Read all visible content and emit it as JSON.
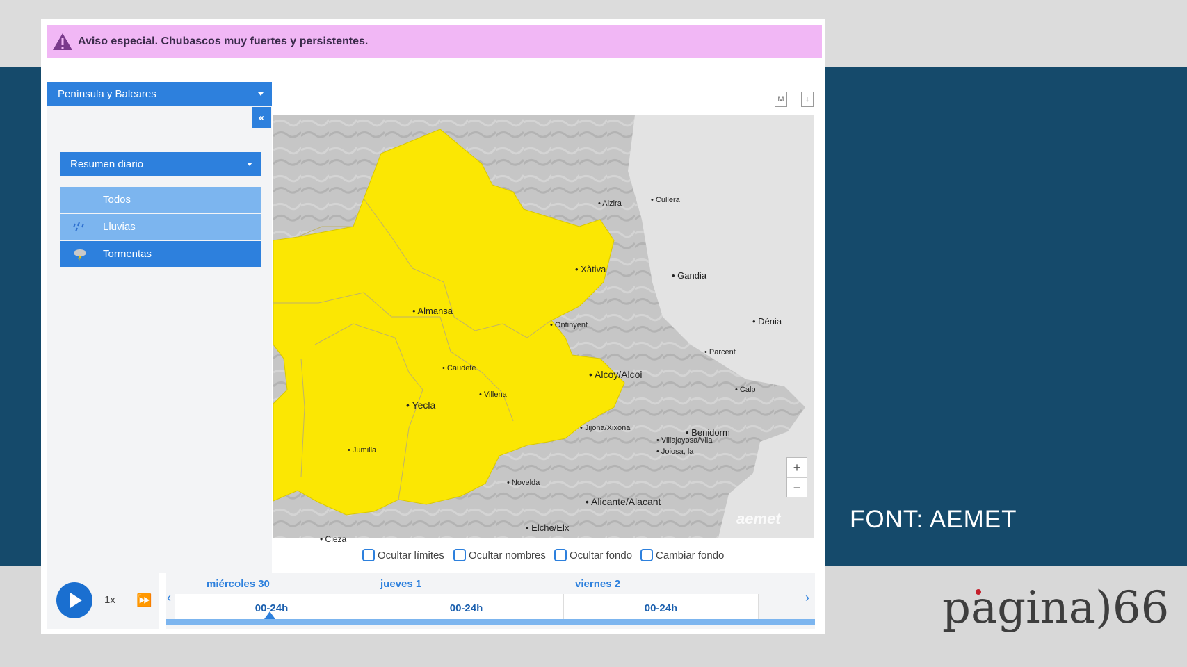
{
  "alert": {
    "text": "Aviso especial. Chubascos muy fuertes y persistentes.",
    "icon": "warning-icon"
  },
  "sidebar": {
    "region": "Península y Baleares",
    "collapse_label": "«",
    "summary": "Resumen diario",
    "filters": [
      {
        "label": "Todos",
        "icon": ""
      },
      {
        "label": "Lluvias",
        "icon": "rain-icon"
      },
      {
        "label": "Tormentas",
        "icon": "storm-icon"
      }
    ]
  },
  "toolbar": {
    "m_label": "M",
    "download_label": "↓"
  },
  "map": {
    "warning_color": "#fbe703",
    "zoom_in": "+",
    "zoom_out": "−",
    "watermark": "aemet",
    "places": [
      "Alzira",
      "Cullera",
      "Xàtiva",
      "Gandia",
      "Almansa",
      "Ontinyent",
      "Dénia",
      "Parcent",
      "Caudete",
      "Alcoy/Alcoi",
      "Calp",
      "Villena",
      "Yecla",
      "Jijona/Xixona",
      "Benidorm",
      "Villajoyosa/Vila",
      "Joiosa, la",
      "Jumilla",
      "Novelda",
      "Alicante/Alacant",
      "Elche/Elx",
      "Cieza"
    ]
  },
  "options": [
    "Ocultar límites",
    "Ocultar nombres",
    "Ocultar fondo",
    "Cambiar fondo"
  ],
  "player": {
    "speed": "1x",
    "play_icon": "play-icon",
    "ff_icon": "fast-forward-icon"
  },
  "timeline": {
    "days": [
      "miércoles 30",
      "jueves 1",
      "viernes 2"
    ],
    "ranges": [
      "00-24h",
      "00-24h",
      "00-24h"
    ],
    "prev": "‹",
    "next": "›"
  },
  "overlay": {
    "source": "FONT: AEMET",
    "brand": "pagina)66"
  }
}
